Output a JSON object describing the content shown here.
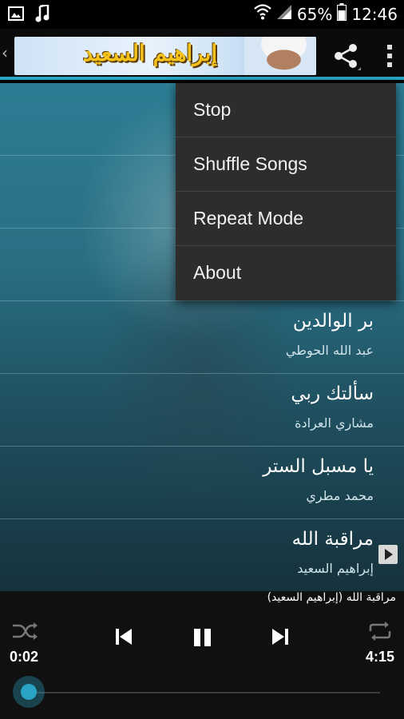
{
  "statusbar": {
    "battery": "65%",
    "time": "12:46"
  },
  "header": {
    "banner_text": "إبراهيم السعيد"
  },
  "menu": {
    "items": [
      "Stop",
      "Shuffle Songs",
      "Repeat Mode",
      "About"
    ]
  },
  "songs": [
    {
      "title": "بر الوالدين",
      "artist": "عبد الله الحوطي"
    },
    {
      "title": "سألتك ربي",
      "artist": "مشاري العرادة"
    },
    {
      "title": "يا مسبل الستر",
      "artist": "محمد مطري"
    },
    {
      "title": "مراقبة الله",
      "artist": "إبراهيم السعيد",
      "playing": true
    }
  ],
  "player": {
    "now_playing": "مراقبة الله (إبراهيم السعيد)",
    "elapsed": "0:02",
    "duration": "4:15",
    "progress": 0.008
  },
  "colors": {
    "accent": "#2aa3c4",
    "menu_bg": "#2d2d2d"
  }
}
